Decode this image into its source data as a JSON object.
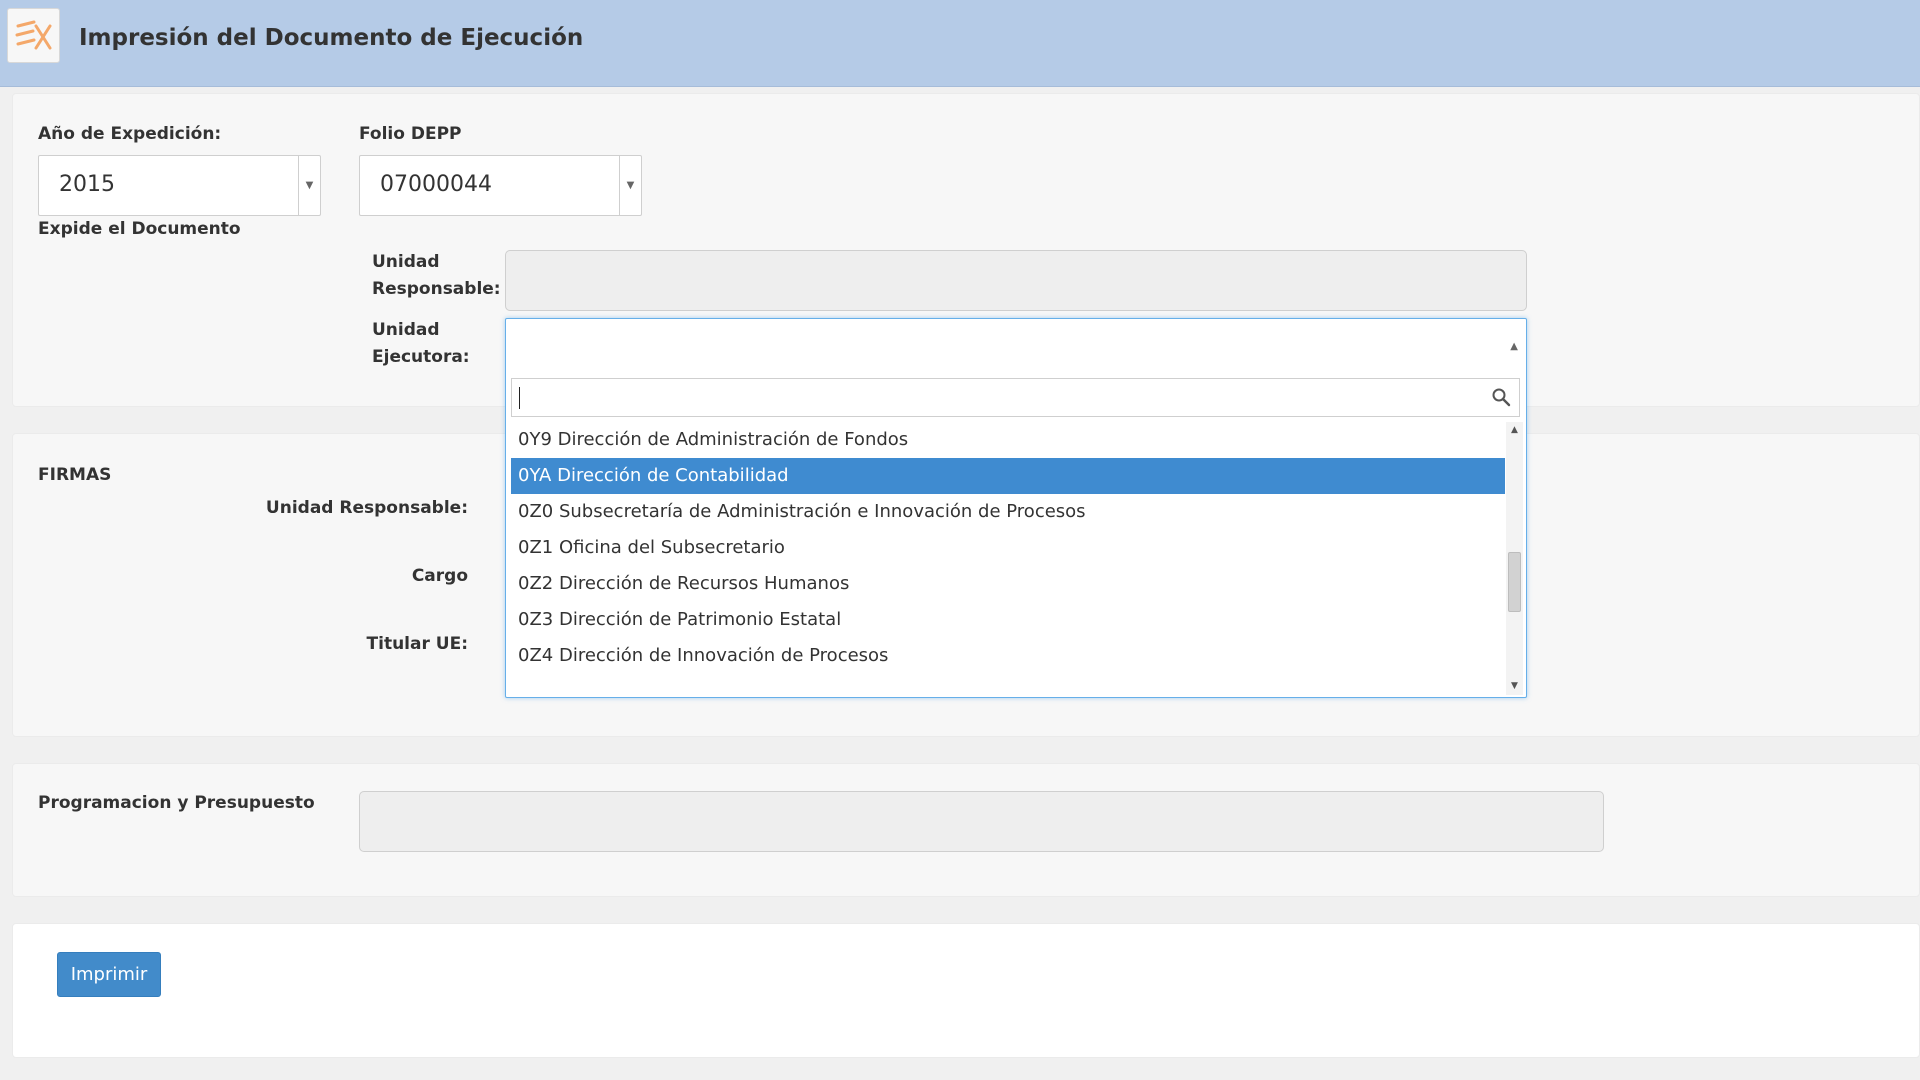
{
  "header": {
    "title": "Impresión del Documento de Ejecución",
    "logo_icon": "ex-logo-icon"
  },
  "documento": {
    "anio_label": "Año de Expedición:",
    "anio_value": "2015",
    "folio_label": "Folio DEPP",
    "folio_value": "07000044",
    "expide_label": "Expide el Documento",
    "unidad_responsable_label_1": "Unidad",
    "unidad_responsable_label_2": "Responsable:",
    "unidad_ejecutora_label_1": "Unidad",
    "unidad_ejecutora_label_2": "Ejecutora:"
  },
  "dropdown": {
    "search_value": "",
    "options": [
      "0Y9 Dirección de Administración de Fondos",
      "0YA Dirección de Contabilidad",
      "0Z0 Subsecretaría de Administración e Innovación de Procesos",
      "0Z1 Oficina del Subsecretario",
      "0Z2 Dirección de Recursos Humanos",
      "0Z3 Dirección de Patrimonio Estatal",
      "0Z4 Dirección de Innovación de Procesos"
    ],
    "selected_index": 1
  },
  "firmas": {
    "title": "FIRMAS",
    "unidad_responsable_label": "Unidad Responsable:",
    "cargo_label": "Cargo",
    "titular_label": "Titular UE:"
  },
  "programacion": {
    "label": "Programacion y Presupuesto"
  },
  "actions": {
    "imprimir_label": "Imprimir"
  },
  "colors": {
    "header_bg": "#b5cbe7",
    "selected_option": "#3f8bd0",
    "primary_button": "#428bca",
    "focus_border": "#66afe9"
  }
}
